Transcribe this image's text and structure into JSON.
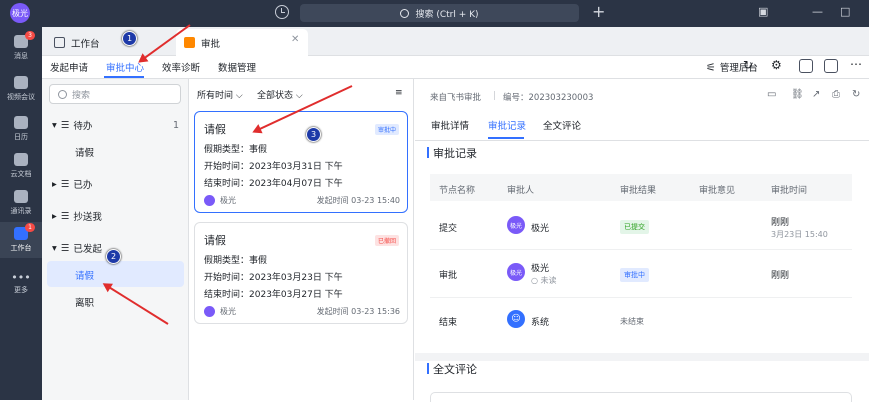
{
  "titlebar": {
    "avatar": "极光",
    "search_placeholder": "搜索 (Ctrl + K)"
  },
  "sidebar": {
    "items": [
      {
        "label": "消息",
        "badge": "3"
      },
      {
        "label": "视频会议",
        "badge": ""
      },
      {
        "label": "日历",
        "badge": ""
      },
      {
        "label": "云文档",
        "badge": ""
      },
      {
        "label": "通讯录",
        "badge": ""
      },
      {
        "label": "工作台",
        "badge": "1"
      },
      {
        "label": "更多",
        "badge": ""
      }
    ]
  },
  "tabs": [
    {
      "label": "工作台"
    },
    {
      "label": "审批"
    }
  ],
  "toolbar": {
    "nav": [
      "发起申请",
      "审批中心",
      "效率诊断",
      "数据管理"
    ],
    "admin": "管理后台"
  },
  "left": {
    "search_placeholder": "搜索",
    "groups": [
      {
        "label": "待办",
        "count": "1"
      },
      {
        "label": "已办",
        "count": ""
      },
      {
        "label": "抄送我",
        "count": ""
      },
      {
        "label": "已发起",
        "count": ""
      }
    ],
    "subs": [
      "请假",
      "请假",
      "离职"
    ]
  },
  "list": {
    "filters": [
      "所有时间",
      "全部状态"
    ],
    "cards": [
      {
        "title": "请假",
        "status": "审批中",
        "type_label": "假期类型：",
        "type": "事假",
        "start_label": "开始时间：",
        "start": "2023年03月31日 下午",
        "end_label": "结束时间：",
        "end": "2023年04月07日 下午",
        "who": "极光",
        "when": "发起时间 03-23 15:40"
      },
      {
        "title": "请假",
        "status": "已撤回",
        "type_label": "假期类型：",
        "type": "事假",
        "start_label": "开始时间：",
        "start": "2023年03月23日 下午",
        "end_label": "结束时间：",
        "end": "2023年03月27日 下午",
        "who": "极光",
        "when": "发起时间 03-23 15:36"
      }
    ]
  },
  "detail": {
    "source": "来自飞书审批",
    "number": "编号：202303230003",
    "tabs": [
      "审批详情",
      "审批记录",
      "全文评论"
    ],
    "section_record": "审批记录",
    "headers": [
      "节点名称",
      "审批人",
      "审批结果",
      "审批意见",
      "审批时间"
    ],
    "rows": [
      {
        "node": "提交",
        "avatar": "极光",
        "name": "极光",
        "sub": "",
        "result": "已提交",
        "time": "刚刚",
        "time2": "3月23日 15:40"
      },
      {
        "node": "审批",
        "avatar": "极光",
        "name": "极光",
        "sub": "未读",
        "result": "审批中",
        "time": "刚刚",
        "time2": ""
      },
      {
        "node": "结束",
        "avatar": "",
        "name": "系统",
        "sub": "",
        "result": "未结束",
        "time": "",
        "time2": ""
      }
    ],
    "section_comment": "全文评论"
  },
  "annotations": [
    "1",
    "2",
    "3"
  ],
  "colors": {
    "accent": "#3370ff",
    "arrow": "#e02d2d",
    "dark": "#2b3445"
  }
}
